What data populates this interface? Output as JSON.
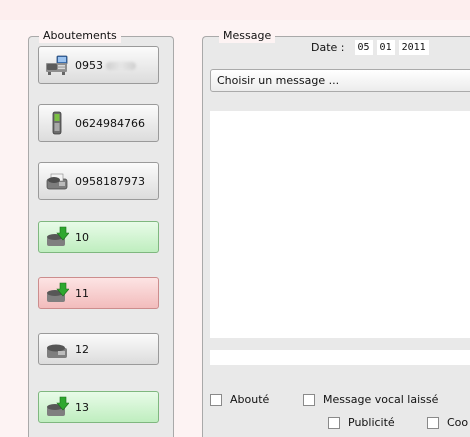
{
  "abouts": {
    "legend": "Aboutements",
    "buttons": [
      {
        "label": "0953",
        "icon": "desk-phone-computer-icon",
        "state": "normal"
      },
      {
        "label": "0624984766",
        "icon": "mobile-phone-icon",
        "state": "normal"
      },
      {
        "label": "0958187973",
        "icon": "fax-machine-icon",
        "state": "normal"
      },
      {
        "label": "10",
        "icon": "phone-green-arrow-icon",
        "state": "green"
      },
      {
        "label": "11",
        "icon": "phone-green-arrow-icon",
        "state": "red"
      },
      {
        "label": "12",
        "icon": "phone-icon",
        "state": "normal"
      },
      {
        "label": "13",
        "icon": "phone-green-arrow-icon",
        "state": "green"
      }
    ]
  },
  "message": {
    "legend": "Message",
    "date_label": "Date :",
    "date_day": "05",
    "date_month": "01",
    "date_year": "2011",
    "select_value": "Choisir un message ...",
    "checkboxes": {
      "aboute": "Abouté",
      "message_vocal": "Message vocal laissé",
      "publicite": "Publicité",
      "coo": "Coo"
    }
  },
  "colors": {
    "green": "#c9f2c9",
    "red": "#f6caca",
    "panel": "#e9e9e9"
  }
}
